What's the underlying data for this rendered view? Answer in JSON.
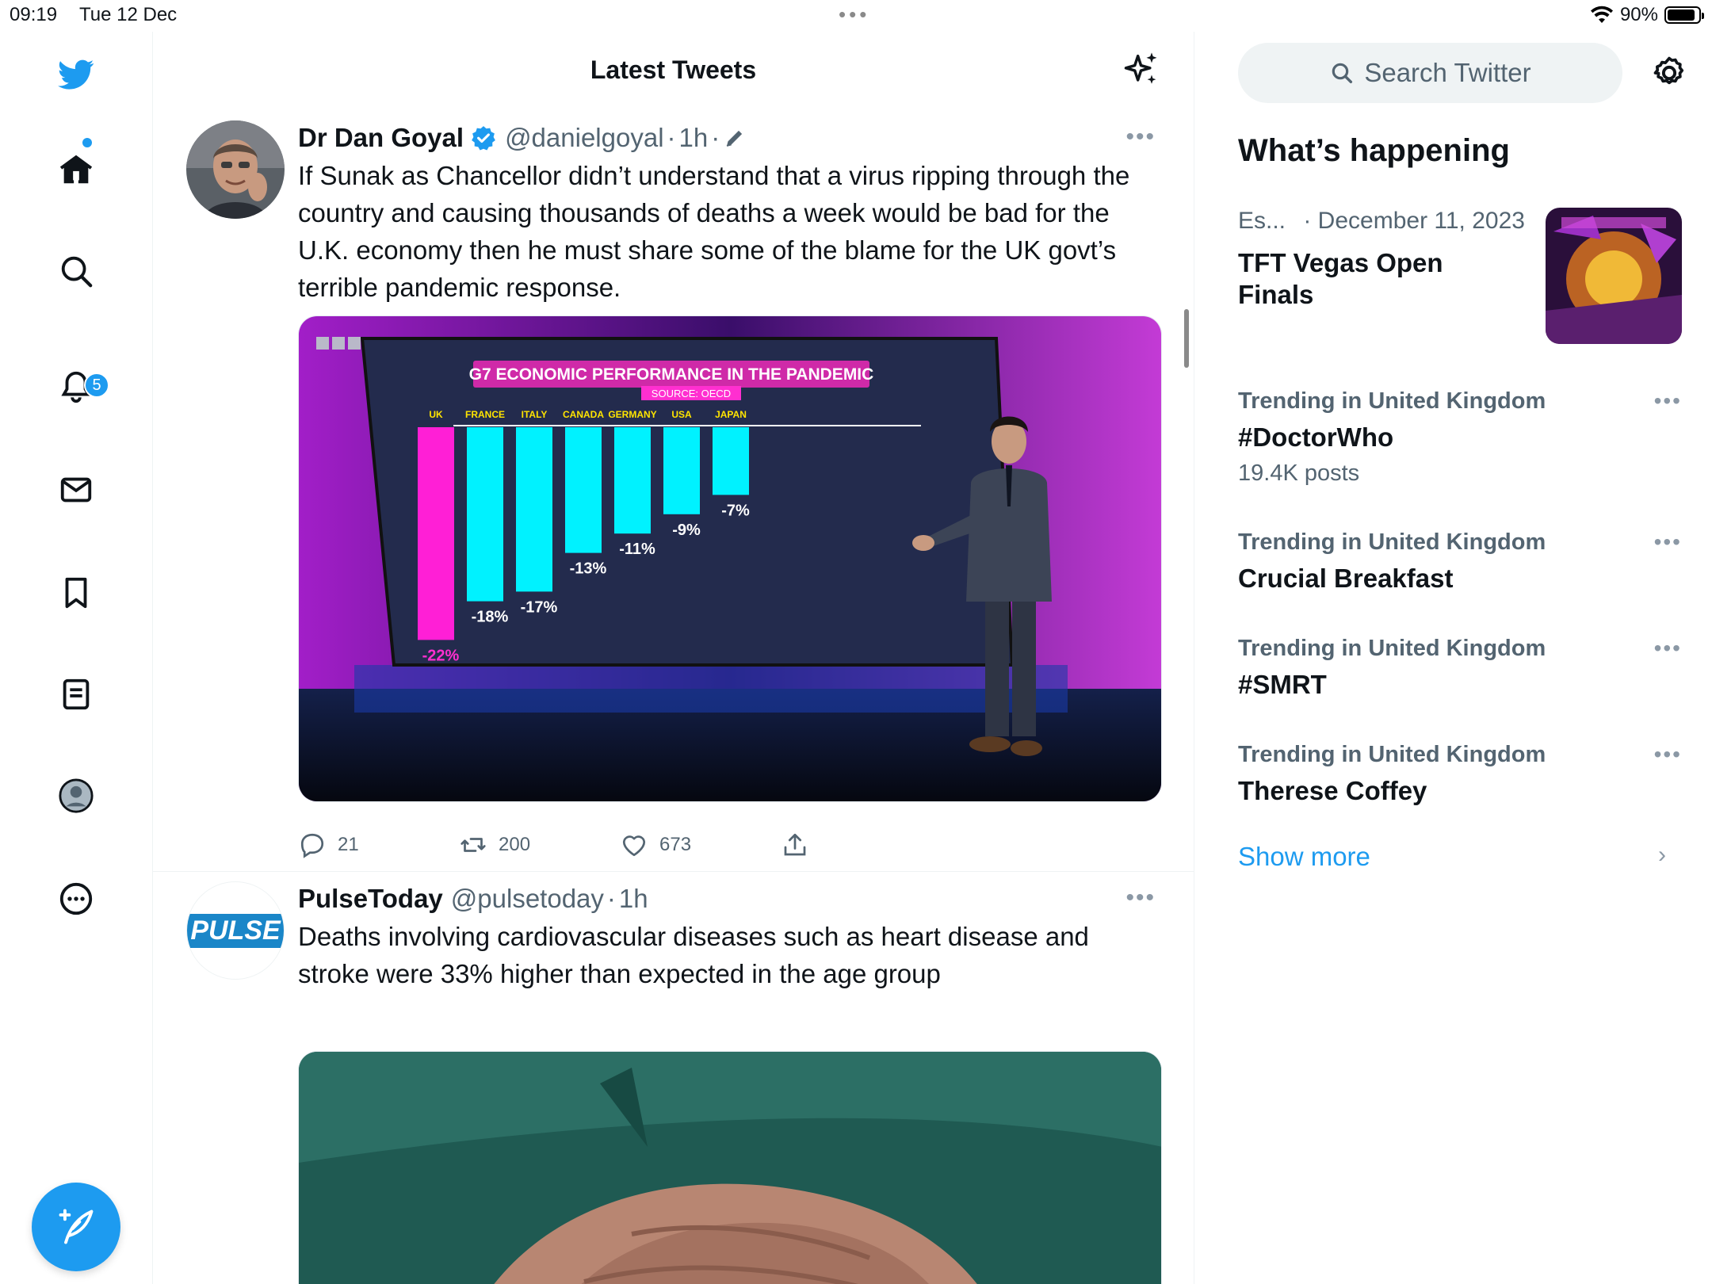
{
  "status_bar": {
    "time": "09:19",
    "date": "Tue 12 Dec",
    "battery": "90%",
    "battery_level": 0.9,
    "wifi_icon": "wifi-icon"
  },
  "nav": {
    "notifications_badge": "5",
    "icons": [
      "twitter-logo-icon",
      "home-icon",
      "search-icon",
      "bell-icon",
      "mail-icon",
      "bookmark-icon",
      "list-icon",
      "avatar-icon",
      "more-icon"
    ],
    "compose_icon": "compose-icon"
  },
  "timeline": {
    "title": "Latest Tweets",
    "tweets": [
      {
        "name": "Dr Dan Goyal",
        "handle": "@danielgoyal",
        "dot": "·",
        "time": "1h",
        "dot2": "·",
        "text": "If Sunak as Chancellor didn’t understand that a virus ripping through the country and causing thousands of deaths a week would be bad for the U.K. economy then he must share some of the blame for the UK govt’s terrible pandemic response.",
        "replies": "21",
        "retweets": "200",
        "likes": "673",
        "media": {
          "logo": "BBC",
          "chart_title": "G7 ECONOMIC PERFORMANCE IN THE PANDEMIC",
          "chart_source": "SOURCE: OECD",
          "bars": [
            {
              "country": "UK",
              "label": "-22%",
              "value": -22,
              "color": "#ff1fd6"
            },
            {
              "country": "FRANCE",
              "label": "-18%",
              "value": -18,
              "color": "#00f2ff"
            },
            {
              "country": "ITALY",
              "label": "-17%",
              "value": -17,
              "color": "#00f2ff"
            },
            {
              "country": "CANADA",
              "label": "-13%",
              "value": -13,
              "color": "#00f2ff"
            },
            {
              "country": "GERMANY",
              "label": "-11%",
              "value": -11,
              "color": "#00f2ff"
            },
            {
              "country": "USA",
              "label": "-9%",
              "value": -9,
              "color": "#00f2ff"
            },
            {
              "country": "JAPAN",
              "label": "-7%",
              "value": -7,
              "color": "#00f2ff"
            }
          ]
        }
      },
      {
        "name": "PulseToday",
        "handle": "@pulsetoday",
        "dot": "·",
        "time": "1h",
        "avatar_text": "PULSE",
        "text": "Deaths involving cardiovascular diseases such as heart disease and stroke were 33% higher than expected in the age group"
      }
    ]
  },
  "sidebar": {
    "search_placeholder": "Search Twitter",
    "whats_happening": "What’s happening",
    "event": {
      "category": "Es...",
      "date": "· December 11, 2023",
      "title": "TFT Vegas Open Finals"
    },
    "trends": [
      {
        "context": "Trending in United Kingdom",
        "name": "#DoctorWho",
        "count": "19.4K posts"
      },
      {
        "context": "Trending in United Kingdom",
        "name": "Crucial Breakfast",
        "count": ""
      },
      {
        "context": "Trending in United Kingdom",
        "name": "#SMRT",
        "count": ""
      },
      {
        "context": "Trending in United Kingdom",
        "name": "Therese Coffey",
        "count": ""
      }
    ],
    "show_more": "Show more"
  },
  "colors": {
    "accent": "#1d9bf0",
    "text_primary": "#0f1419",
    "text_secondary": "#536471"
  }
}
